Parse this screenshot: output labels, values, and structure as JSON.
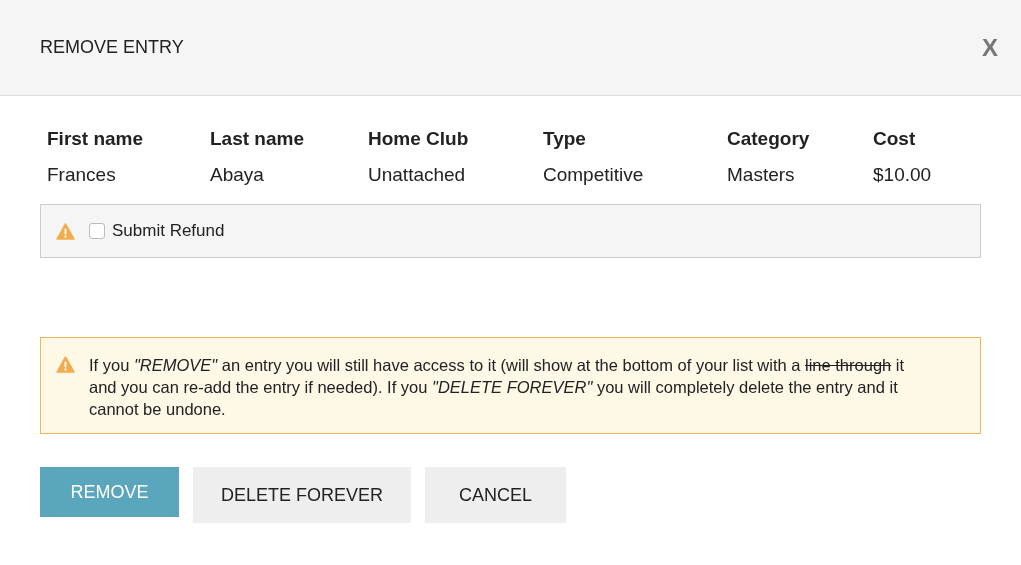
{
  "dialog": {
    "title": "REMOVE ENTRY",
    "close": "X"
  },
  "table": {
    "columns": [
      "First name",
      "Last name",
      "Home Club",
      "Type",
      "Category",
      "Cost"
    ],
    "rows": [
      [
        "Frances",
        "Abaya",
        "Unattached",
        "Competitive",
        "Masters",
        "$10.00"
      ]
    ]
  },
  "refund": {
    "label": "Submit Refund",
    "checked": false
  },
  "notice": {
    "parts": [
      {
        "text": "If you ",
        "kind": "plain"
      },
      {
        "text": "\"REMOVE\"",
        "kind": "quote"
      },
      {
        "text": " an entry you will still have access to it (will show at the bottom of your list with a ",
        "kind": "plain"
      },
      {
        "text": "line through",
        "kind": "example"
      },
      {
        "text": " it and you can re-add the entry if needed). If you ",
        "kind": "plain"
      },
      {
        "text": "\"DELETE FOREVER\"",
        "kind": "quote"
      },
      {
        "text": " you will completely delete the entry and it cannot be undone.",
        "kind": "plain"
      }
    ]
  },
  "buttons": [
    {
      "label": "REMOVE",
      "kind": "primary"
    },
    {
      "label": "DELETE FOREVER",
      "kind": "secondary"
    },
    {
      "label": "CANCEL",
      "kind": "secondary"
    }
  ]
}
